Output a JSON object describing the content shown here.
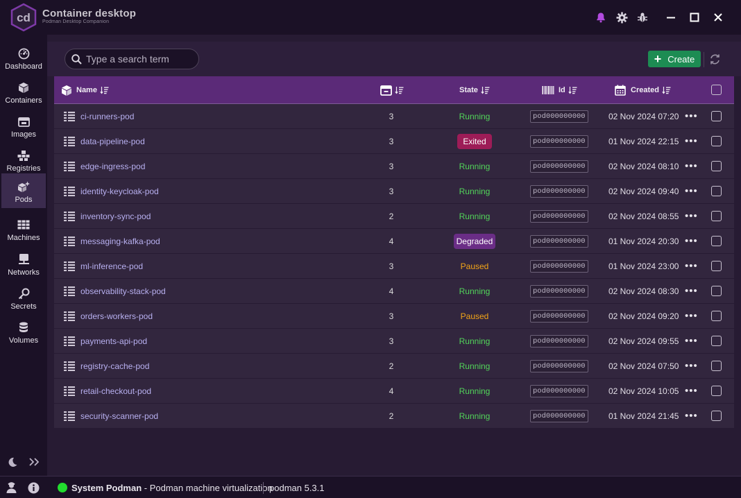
{
  "app": {
    "title": "Container desktop",
    "subtitle": "Podman Desktop Companion",
    "logo_text": "cd"
  },
  "window": {
    "icons": [
      "bell-icon",
      "gear-icon",
      "bug-icon"
    ],
    "controls": [
      "minimize",
      "maximize",
      "close"
    ]
  },
  "nav": {
    "items": [
      {
        "label": "Dashboard",
        "icon": "dashboard-icon",
        "active": false
      },
      {
        "label": "Containers",
        "icon": "cube-icon",
        "active": false
      },
      {
        "label": "Images",
        "icon": "image-icon",
        "active": false
      },
      {
        "label": "Registries",
        "icon": "registries-icon",
        "active": false
      },
      {
        "label": "Pods",
        "icon": "pods-icon",
        "active": true
      },
      {
        "label": "Machines",
        "icon": "machines-icon",
        "active": false
      },
      {
        "label": "Networks",
        "icon": "network-icon",
        "active": false
      },
      {
        "label": "Secrets",
        "icon": "key-icon",
        "active": false
      },
      {
        "label": "Volumes",
        "icon": "database-icon",
        "active": false
      }
    ]
  },
  "toolbar": {
    "search_placeholder": "Type a search term",
    "create_label": "Create"
  },
  "table": {
    "columns": {
      "name": "Name",
      "containers": "",
      "state": "State",
      "id": "Id",
      "created": "Created"
    },
    "rows": [
      {
        "name": "ci-runners-pod",
        "containers": "3",
        "state": "Running",
        "id": "pod000000000",
        "created": "02 Nov 2024 07:20"
      },
      {
        "name": "data-pipeline-pod",
        "containers": "3",
        "state": "Exited",
        "id": "pod000000000",
        "created": "01 Nov 2024 22:15"
      },
      {
        "name": "edge-ingress-pod",
        "containers": "3",
        "state": "Running",
        "id": "pod000000000",
        "created": "02 Nov 2024 08:10"
      },
      {
        "name": "identity-keycloak-pod",
        "containers": "3",
        "state": "Running",
        "id": "pod000000000",
        "created": "02 Nov 2024 09:40"
      },
      {
        "name": "inventory-sync-pod",
        "containers": "2",
        "state": "Running",
        "id": "pod000000000",
        "created": "02 Nov 2024 08:55"
      },
      {
        "name": "messaging-kafka-pod",
        "containers": "4",
        "state": "Degraded",
        "id": "pod000000000",
        "created": "01 Nov 2024 20:30"
      },
      {
        "name": "ml-inference-pod",
        "containers": "3",
        "state": "Paused",
        "id": "pod000000000",
        "created": "01 Nov 2024 23:00"
      },
      {
        "name": "observability-stack-pod",
        "containers": "4",
        "state": "Running",
        "id": "pod000000000",
        "created": "02 Nov 2024 08:30"
      },
      {
        "name": "orders-workers-pod",
        "containers": "3",
        "state": "Paused",
        "id": "pod000000000",
        "created": "02 Nov 2024 09:20"
      },
      {
        "name": "payments-api-pod",
        "containers": "3",
        "state": "Running",
        "id": "pod000000000",
        "created": "02 Nov 2024 09:55"
      },
      {
        "name": "registry-cache-pod",
        "containers": "2",
        "state": "Running",
        "id": "pod000000000",
        "created": "02 Nov 2024 07:50"
      },
      {
        "name": "retail-checkout-pod",
        "containers": "4",
        "state": "Running",
        "id": "pod000000000",
        "created": "02 Nov 2024 10:05"
      },
      {
        "name": "security-scanner-pod",
        "containers": "2",
        "state": "Running",
        "id": "pod000000000",
        "created": "01 Nov 2024 21:45"
      }
    ]
  },
  "statusbar": {
    "engine_name": "System Podman",
    "engine_desc": " - Podman machine virtualization",
    "version": "podman 5.3.1"
  },
  "colors": {
    "accent": "#5b2a78",
    "running": "#52d65a",
    "paused": "#f2a418",
    "exited": "#9d1c57",
    "degraded": "#6a2d86",
    "create": "#1d8c53",
    "status_dot": "#22dc2e"
  }
}
